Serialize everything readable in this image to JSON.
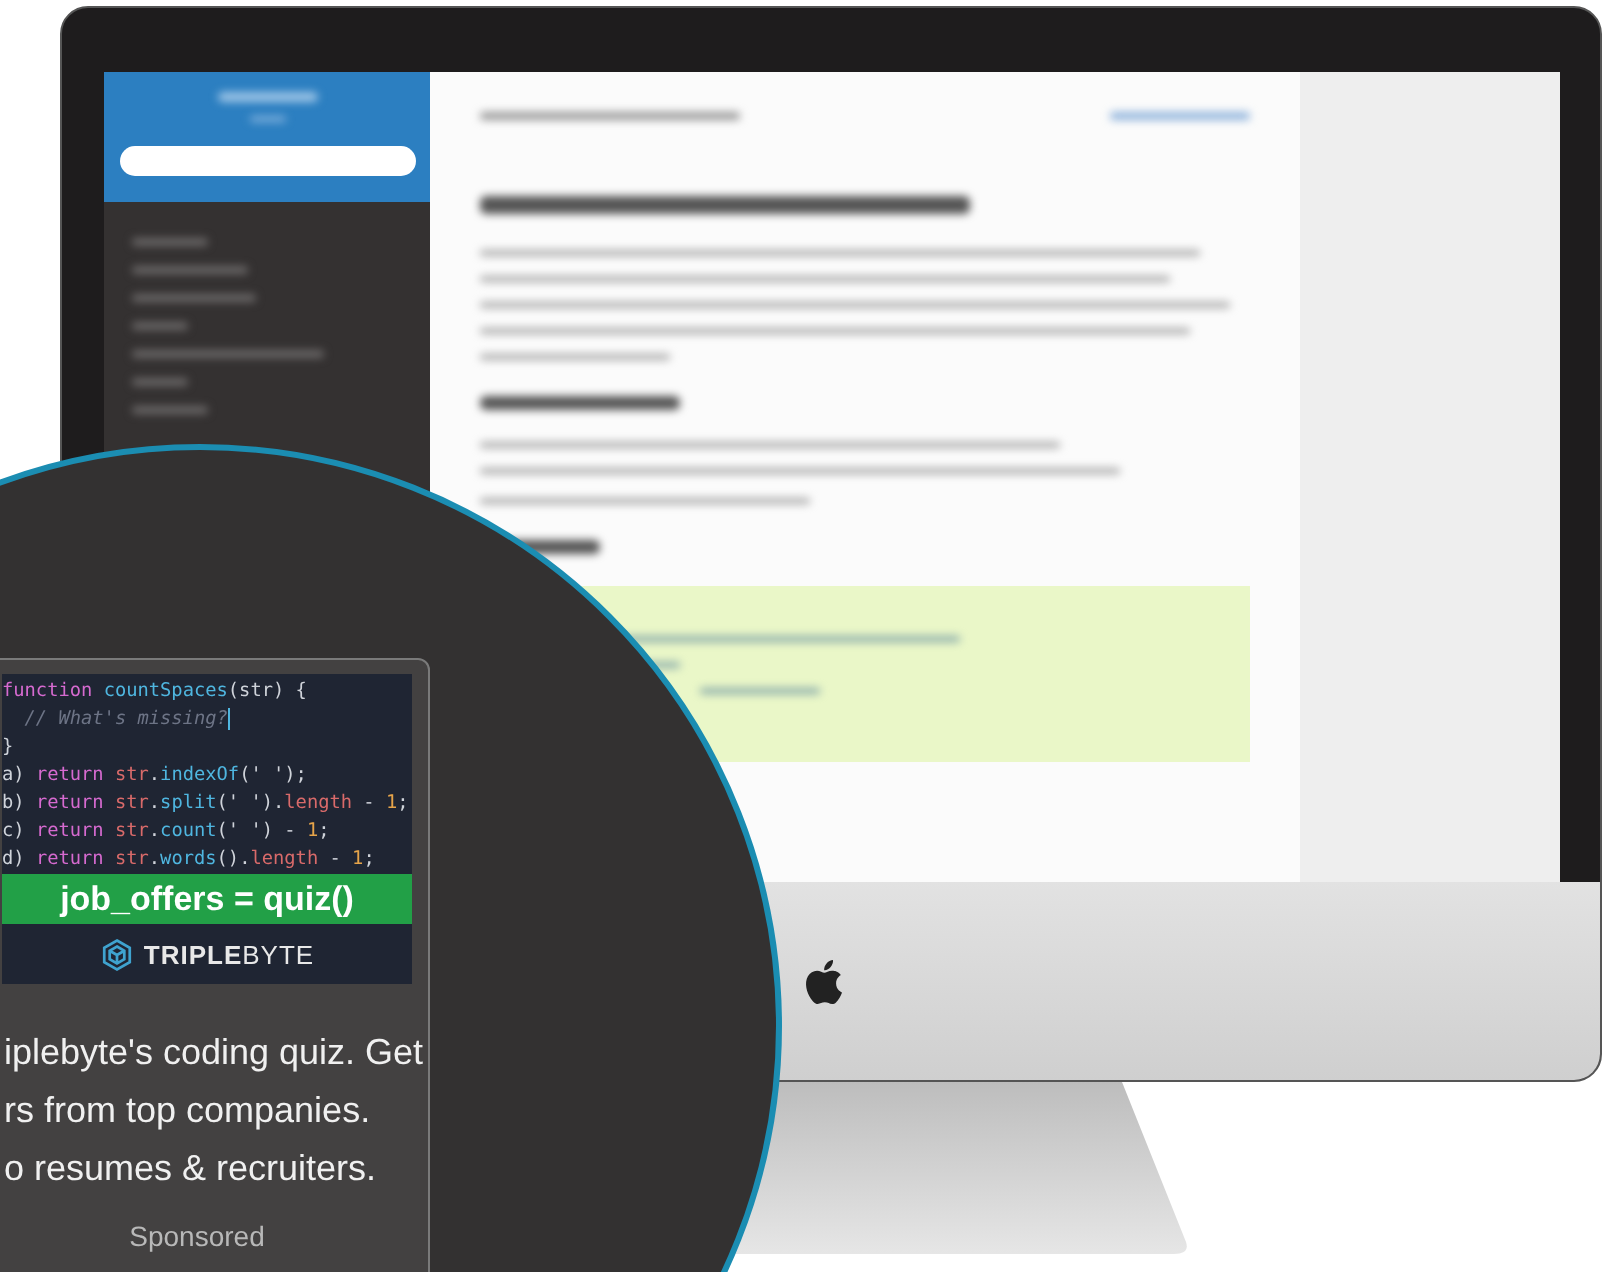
{
  "ad": {
    "code_lines": [
      [
        {
          "kind": "keyword",
          "text": "function "
        },
        {
          "kind": "function",
          "text": "countSpaces"
        },
        {
          "kind": "plain",
          "text": "(str) {"
        }
      ],
      [
        {
          "kind": "comment",
          "text": "  // What's missing?",
          "cursor": true
        }
      ],
      [
        {
          "kind": "plain",
          "text": "}"
        }
      ],
      [
        {
          "kind": "plain",
          "text": "a) "
        },
        {
          "kind": "keyword",
          "text": "return "
        },
        {
          "kind": "variable",
          "text": "str"
        },
        {
          "kind": "plain",
          "text": "."
        },
        {
          "kind": "function",
          "text": "indexOf"
        },
        {
          "kind": "plain",
          "text": "(' ');"
        }
      ],
      [
        {
          "kind": "plain",
          "text": "b) "
        },
        {
          "kind": "keyword",
          "text": "return "
        },
        {
          "kind": "variable",
          "text": "str"
        },
        {
          "kind": "plain",
          "text": "."
        },
        {
          "kind": "function",
          "text": "split"
        },
        {
          "kind": "plain",
          "text": "(' ')."
        },
        {
          "kind": "variable",
          "text": "length"
        },
        {
          "kind": "plain",
          "text": " - "
        },
        {
          "kind": "number",
          "text": "1"
        },
        {
          "kind": "plain",
          "text": ";"
        }
      ],
      [
        {
          "kind": "plain",
          "text": "c) "
        },
        {
          "kind": "keyword",
          "text": "return "
        },
        {
          "kind": "variable",
          "text": "str"
        },
        {
          "kind": "plain",
          "text": "."
        },
        {
          "kind": "function",
          "text": "count"
        },
        {
          "kind": "plain",
          "text": "(' ') - "
        },
        {
          "kind": "number",
          "text": "1"
        },
        {
          "kind": "plain",
          "text": ";"
        }
      ],
      [
        {
          "kind": "plain",
          "text": "d) "
        },
        {
          "kind": "keyword",
          "text": "return "
        },
        {
          "kind": "variable",
          "text": "str"
        },
        {
          "kind": "plain",
          "text": "."
        },
        {
          "kind": "function",
          "text": "words"
        },
        {
          "kind": "plain",
          "text": "()."
        },
        {
          "kind": "variable",
          "text": "length"
        },
        {
          "kind": "plain",
          "text": " - "
        },
        {
          "kind": "number",
          "text": "1"
        },
        {
          "kind": "plain",
          "text": ";"
        }
      ]
    ],
    "banner": "job_offers = quiz()",
    "brand": "**TRIPLE**BYTE",
    "text_lines": [
      "iplebyte's coding quiz. Get",
      "rs from top companies.",
      "o resumes & recruiters."
    ],
    "sponsored": "Sponsored"
  }
}
